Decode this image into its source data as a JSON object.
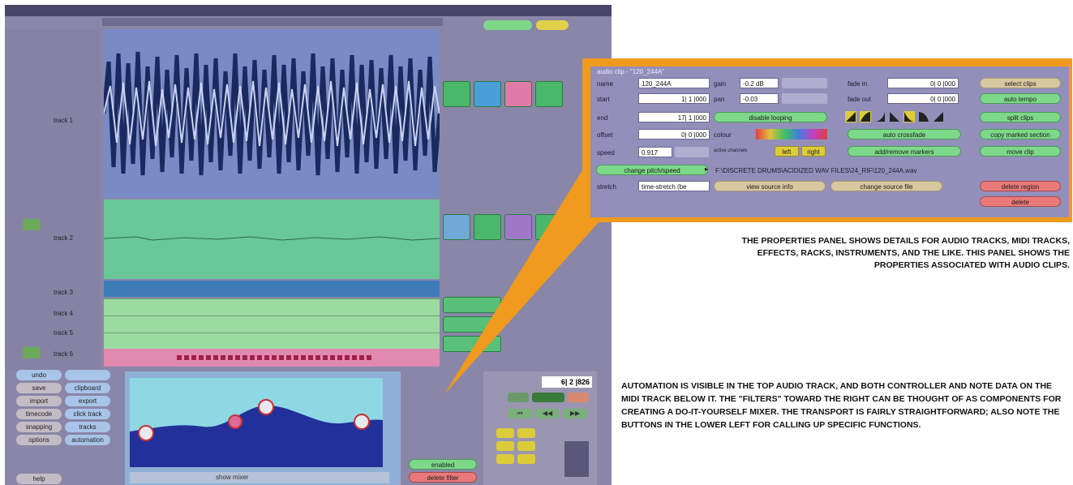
{
  "properties_panel": {
    "title": "audio clip - \"120_244A\"",
    "fields": {
      "name_label": "name",
      "name_value": "120_244A",
      "start_label": "start",
      "start_value": "1| 1 |000",
      "end_label": "end",
      "end_value": "17| 1 |000",
      "offset_label": "offset",
      "offset_value": "0| 0 |000",
      "speed_label": "speed",
      "speed_value": "0.917",
      "stretch_label": "stretch",
      "stretch_value": "time-stretch (be",
      "gain_label": "gain",
      "gain_value": "-0.2 dB",
      "pan_label": "pan",
      "pan_value": "-0.03",
      "colour_label": "colour",
      "active_channels_label": "active channels",
      "fade_in_label": "fade in",
      "fade_in_value": "0| 0 |000",
      "fade_out_label": "fade out",
      "fade_out_value": "0| 0 |000"
    },
    "buttons": {
      "disable_looping": "disable looping",
      "change_pitch_speed": "change pitch/speed",
      "view_source_info": "view source info",
      "change_source_file": "change source file",
      "left": "left",
      "right": "right",
      "auto_crossfade": "auto crossfade",
      "add_remove_markers": "add/remove markers",
      "select_clips": "select clips",
      "auto_tempo": "auto tempo",
      "split_clips": "split clips",
      "copy_marked_section": "copy marked section",
      "move_clip": "move clip",
      "delete_region": "delete region",
      "delete": "delete"
    },
    "source_path": "F:\\DISCRETE DRUMS\\ACIDIZED WAV FILES\\24_RIF\\120_244A.wav"
  },
  "captions": {
    "properties": "THE PROPERTIES PANEL SHOWS DETAILS FOR AUDIO TRACKS, MIDI TRACKS, EFFECTS, RACKS, INSTRUMENTS, AND THE LIKE. THIS PANEL SHOWS THE PROPERTIES ASSOCIATED WITH AUDIO CLIPS.",
    "automation": "AUTOMATION IS VISIBLE IN THE TOP AUDIO TRACK, AND BOTH CONTROLLER AND NOTE DATA ON THE MIDI TRACK BELOW IT. THE \"FILTERS\" TOWARD THE RIGHT CAN BE THOUGHT OF AS COMPONENTS FOR CREATING A DO-IT-YOURSELF MIXER. THE TRANSPORT IS FAIRLY STRAIGHTFORWARD; ALSO NOTE THE BUTTONS IN THE LOWER LEFT FOR CALLING UP SPECIFIC FUNCTIONS."
  },
  "left_buttons": {
    "undo": "undo",
    "save": "save",
    "clipboard": "clipboard",
    "import": "import",
    "export": "export",
    "timecode": "timecode",
    "click_track": "click track",
    "snapping": "snapping",
    "tracks": "tracks",
    "options": "options",
    "automation": "automation",
    "help": "help"
  },
  "transport": {
    "position": "6| 2 |826"
  },
  "automation_panel": {
    "delete_filter": "delete filter",
    "enabled": "enabled",
    "show_mixer": "show mixer"
  },
  "tracks": {
    "track1": "track 1",
    "track2": "track 2",
    "track3": "track 3",
    "track4": "track 4",
    "track5": "track 5",
    "track6": "track 6"
  },
  "colors": {
    "callout_orange": "#f09a1e",
    "panel_purple": "#9290ba",
    "button_green": "#7ed88a",
    "button_red": "#ea7a7a"
  }
}
